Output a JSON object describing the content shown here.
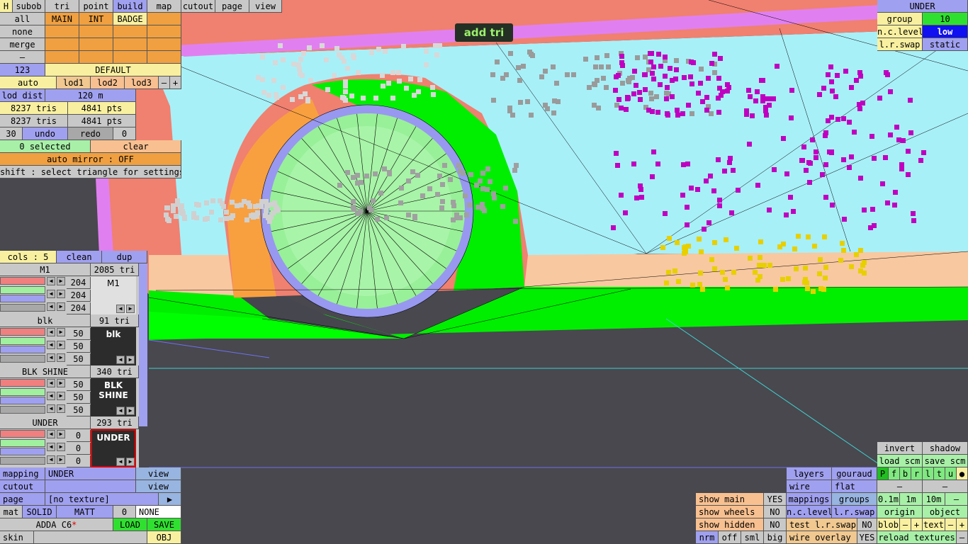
{
  "toolbar": {
    "h": "H",
    "tabs": [
      "subob",
      "tri",
      "point",
      "build",
      "map",
      "cutout",
      "page",
      "view"
    ],
    "active": "build"
  },
  "mode_label": "add tri",
  "left_panel": {
    "all": "all",
    "none": "none",
    "merge": "merge",
    "dash": "–",
    "cats": [
      "MAIN",
      "INT",
      "BADGE"
    ],
    "num": "123",
    "default": "DEFAULT",
    "auto": "auto",
    "lods": [
      "lod1",
      "lod2",
      "lod3"
    ],
    "minus": "–",
    "plus": "+",
    "lod_dist_label": "lod dist",
    "lod_dist_value": "120 m",
    "tris1": "8237 tris",
    "pts1": "4841 pts",
    "tris2": "8237 tris",
    "pts2": "4841 pts",
    "undo_count": "30",
    "undo": "undo",
    "redo": "redo",
    "redo_count": "0",
    "selected": "0 selected",
    "clear": "clear",
    "auto_mirror": "auto mirror : OFF",
    "shift_hint": "shift : select triangle for settings"
  },
  "materials_panel": {
    "cols": "cols : 5",
    "clean": "clean",
    "dup": "dup",
    "materials": [
      {
        "name": "M1",
        "tris": "2085 tri",
        "vals": [
          "204",
          "204",
          "204"
        ],
        "preview": "M1",
        "light": true
      },
      {
        "name": "blk",
        "tris": "91 tri",
        "vals": [
          "50",
          "50",
          "50"
        ],
        "preview": "blk",
        "light": false
      },
      {
        "name": "BLK SHINE",
        "tris": "340 tri",
        "vals": [
          "50",
          "50",
          "50"
        ],
        "preview": "BLK SHINE",
        "light": false
      },
      {
        "name": "UNDER",
        "tris": "293 tri",
        "vals": [
          "0",
          "0",
          "0"
        ],
        "preview": "UNDER",
        "light": false,
        "selected": true
      }
    ]
  },
  "bottom_left": {
    "mapping_label": "mapping",
    "mapping_value": "UNDER",
    "view1": "view",
    "cutout_label": "cutout",
    "view2": "view",
    "page_label": "page",
    "page_value": "[no texture]",
    "page_arrow": "▶",
    "mat": "mat",
    "solid": "SOLID",
    "matt": "MATT",
    "mat_num": "0",
    "none": "NONE",
    "car_name": "ADDA C6",
    "car_star": "*",
    "load": "LOAD",
    "save": "SAVE",
    "skin": "skin",
    "obj": "OBJ"
  },
  "top_right": {
    "title": "UNDER",
    "group_label": "group",
    "group_value": "10",
    "nclevel_label": "n.c.level",
    "nclevel_value": "low",
    "lrswap_label": "l.r.swap",
    "lrswap_value": "static"
  },
  "bottom_right": {
    "show_main": "show main",
    "show_main_v": "YES",
    "show_wheels": "show wheels",
    "show_wheels_v": "NO",
    "show_hidden": "show hidden",
    "show_hidden_v": "NO",
    "nrm": "nrm",
    "off": "off",
    "sml": "sml",
    "big": "big",
    "layers": "layers",
    "gouraud": "gouraud",
    "wire": "wire",
    "flat": "flat",
    "mappings": "mappings",
    "groups": "groups",
    "nclevel": "n.c.level",
    "lrswap": "l.r.swap",
    "test_lrswap": "test l.r.swap",
    "test_lrswap_v": "NO",
    "wire_overlay": "wire overlay",
    "wire_overlay_v": "YES",
    "invert": "invert",
    "shadow": "shadow",
    "load_scm": "load scm",
    "save_scm": "save scm",
    "letters": [
      "P",
      "f",
      "b",
      "r",
      "l",
      "t",
      "u",
      "●"
    ],
    "dash1": "–",
    "dash2": "–",
    "m01": "0.1m",
    "m1": "1m",
    "m10": "10m",
    "mdash": "–",
    "origin": "origin",
    "object": "object",
    "blob": "blob",
    "text": "text",
    "minus": "–",
    "plus": "+",
    "reload": "reload textures",
    "rdash": "–"
  },
  "colors": {
    "sky": "#a8f0f8",
    "green": "#00ff00",
    "salmon": "#f08070",
    "orange": "#f8a040",
    "peach": "#f8c8a0",
    "ground": "#48484e",
    "magenta": "#d000c8",
    "lightgreen": "#98f098",
    "periwinkle": "#9898f0"
  }
}
